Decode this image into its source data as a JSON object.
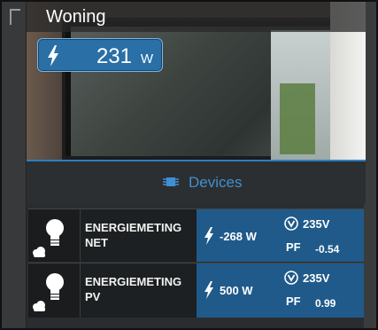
{
  "header": {
    "title": "Woning",
    "power": {
      "value": "231",
      "unit": "W"
    }
  },
  "section": {
    "label": "Devices"
  },
  "devices": [
    {
      "name_line1": "ENERGIEMETING",
      "name_line2": "NET",
      "watts": "-268 W",
      "volts": "235V",
      "pf_label": "PF",
      "pf": "-0.54"
    },
    {
      "name_line1": "ENERGIEMETING",
      "name_line2": "PV",
      "watts": "500 W",
      "volts": "235V",
      "pf_label": "PF",
      "pf": "0.99"
    }
  ],
  "colors": {
    "accent": "#2f7fc0",
    "stats_bg": "#1f5a8a",
    "pill_bg": "#2a6fa6"
  }
}
